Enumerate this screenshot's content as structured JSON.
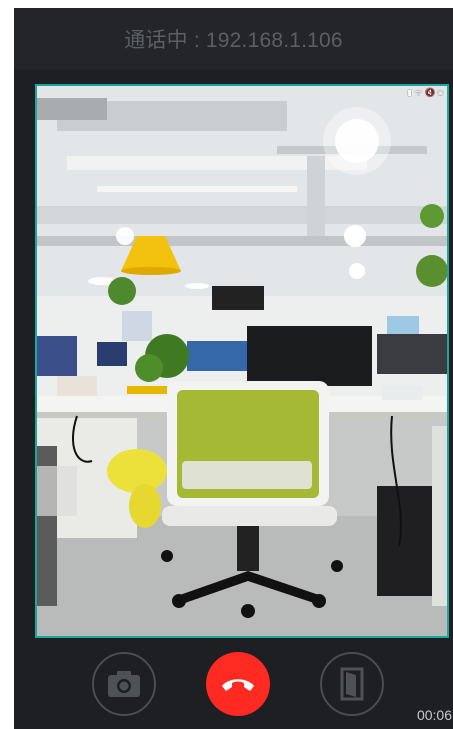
{
  "header": {
    "title": "通话中 : 192.168.1.106"
  },
  "video": {
    "status_icons": [
      "battery-icon",
      "wifi-icon",
      "mute-icon",
      "camera-icon"
    ]
  },
  "controls": {
    "snapshot_icon": "camera-icon",
    "hangup_icon": "phone-hangup-icon",
    "door_icon": "door-open-icon",
    "hangup_color": "#ff2a22",
    "accent_color": "#1aa79d"
  },
  "call": {
    "duration": "00:06"
  }
}
